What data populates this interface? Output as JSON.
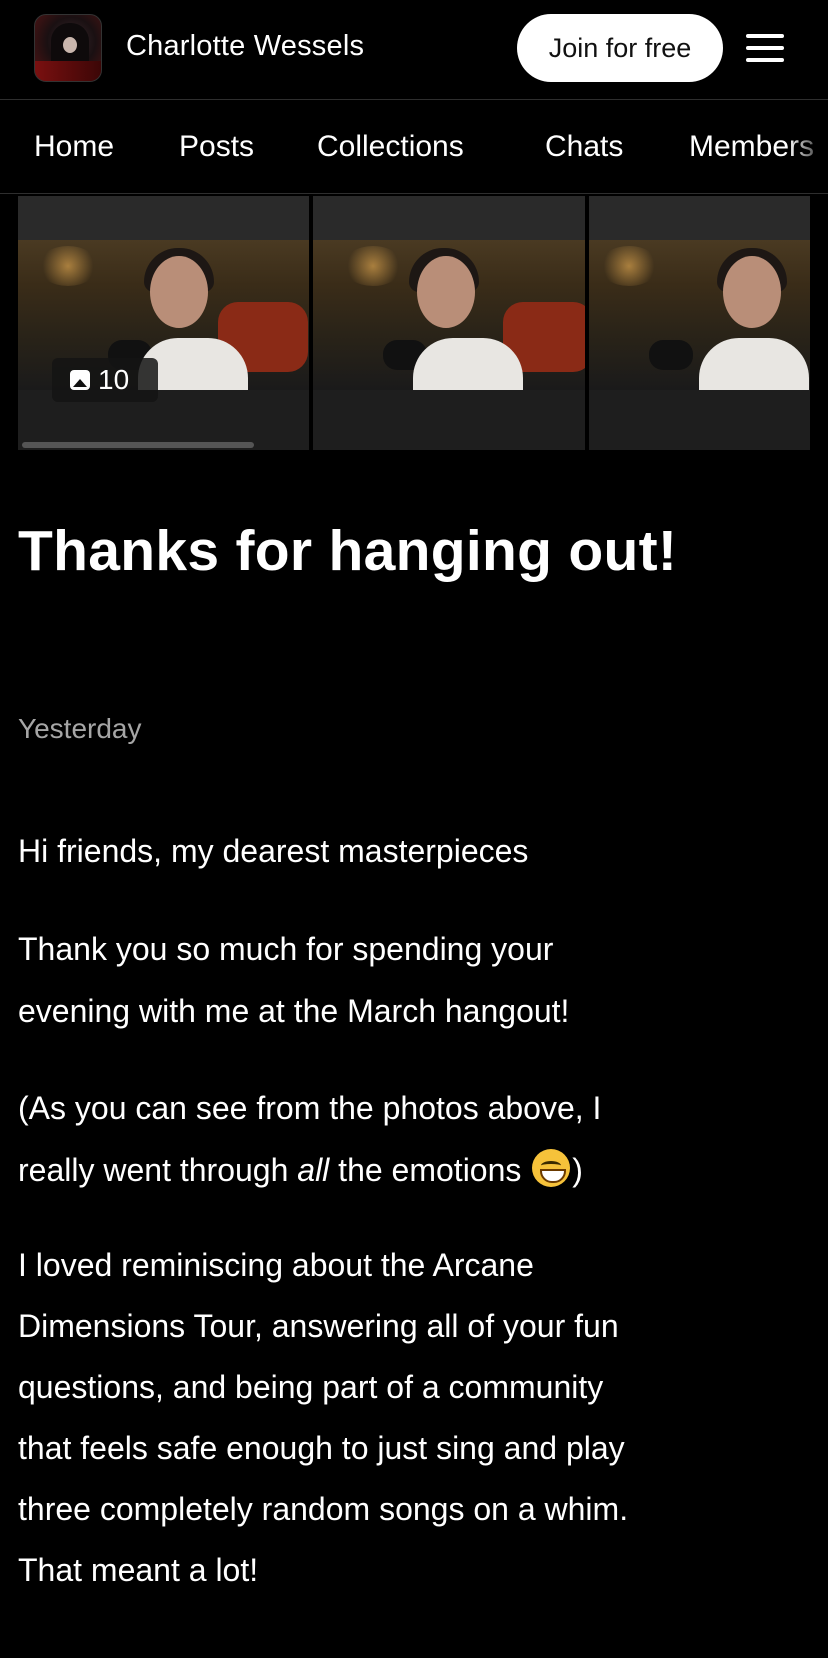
{
  "header": {
    "creator_name": "Charlotte Wessels",
    "join_label": "Join for free",
    "menu_icon": "hamburger-menu-icon"
  },
  "nav": {
    "items": [
      {
        "label": "Home"
      },
      {
        "label": "Posts"
      },
      {
        "label": "Collections"
      },
      {
        "label": "Chats"
      },
      {
        "label": "Members"
      }
    ]
  },
  "gallery": {
    "photo_count": "10",
    "count_icon": "image-icon"
  },
  "post": {
    "title": "Thanks for hanging out!",
    "date": "Yesterday",
    "body": {
      "p1": "Hi friends, my dearest masterpieces",
      "p2_l1": "Thank you so much for spending your",
      "p2_l2": "evening with me at the March hangout!",
      "p3_l1": "(As you can see from the photos above, I",
      "p3_l2_a": "really went through ",
      "p3_l2_em": "all",
      "p3_l2_b": " the emotions ",
      "p3_l2_c": ")",
      "p4_l1": "I loved reminiscing about the Arcane",
      "p4_l2": "Dimensions Tour, answering all of your fun",
      "p4_l3": "questions, and being part of a community",
      "p4_l4": "that feels safe enough to just sing and play",
      "p4_l5": "three completely random songs on a whim.",
      "p4_l6": "That meant a lot!"
    }
  }
}
